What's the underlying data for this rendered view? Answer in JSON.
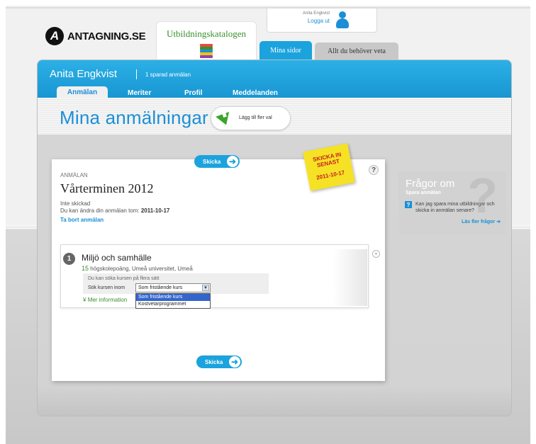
{
  "logo": {
    "mark": "A",
    "text": "ANTAGNING.SE"
  },
  "catalog_tab": {
    "label": "Utbildningskatalogen"
  },
  "user": {
    "name": "Anita Engkvist",
    "logout": "Logga ut"
  },
  "top_tabs": {
    "mina_sidor": "Mina sidor",
    "allt": "Allt du behöver veta"
  },
  "header": {
    "owner": "Anita Engkvist",
    "saved": "1 sparad anmälan",
    "tabs": [
      "Anmälan",
      "Meriter",
      "Profil",
      "Meddelanden"
    ]
  },
  "page": {
    "title": "Mina anmälningar",
    "add_choice": "Lägg till fler val"
  },
  "send_button": "Skicka",
  "deadline_note": {
    "line1": "SKICKA IN\nSENAST",
    "date": "2011-10-17"
  },
  "help_icon": "?",
  "application": {
    "label": "ANMÄLAN",
    "semester": "Vårterminen 2012",
    "status": "Inte skickad",
    "edit_prefix": "Du kan ändra din anmälan tom:",
    "edit_date": "2011-10-17",
    "remove": "Ta bort anmälan"
  },
  "course": {
    "number": "1",
    "name": "Miljö och samhälle",
    "points": "15",
    "details": "högskolepoäng, Umeå universitet, Umeå",
    "hint": "Du kan söka kursen på flera sätt",
    "search_label": "Sök kursen inom",
    "selected": "Som fristående kurs",
    "options": [
      "Som fristående kurs",
      "Kostvetarprogrammet"
    ],
    "more_info": "Mer information",
    "close": "×"
  },
  "faq": {
    "title": "Frågor om",
    "subtitle": "Spara anmälan",
    "question": "Kan jag spara mina utbildningar och skicka in anmälan senare?",
    "more": "Läs fler frågor"
  },
  "colors": {
    "brand_blue": "#1ba3dd",
    "green": "#3a8f2a",
    "sticky": "#f6e224"
  }
}
